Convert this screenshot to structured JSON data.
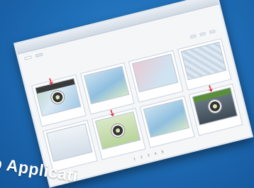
{
  "dialog": {
    "title": "",
    "subtitle": "",
    "tabs": [
      "",
      ""
    ],
    "links": [
      "",
      "",
      ""
    ],
    "tiles": [
      {
        "caption": "",
        "style": "t-map"
      },
      {
        "caption": "",
        "style": "t-map2"
      },
      {
        "caption": "",
        "style": "t-pink"
      },
      {
        "caption": "",
        "style": "t-stripe"
      },
      {
        "caption": "",
        "style": "t-light"
      },
      {
        "caption": "",
        "style": "t-green"
      },
      {
        "caption": "",
        "style": "t-map2"
      },
      {
        "caption": "",
        "style": "t-dark"
      }
    ],
    "pager": "1 2 3 4 5"
  },
  "caption": {
    "text": "eb Applicati"
  },
  "colors": {
    "background": "#1f6fb8",
    "arrow": "#e0303c"
  }
}
